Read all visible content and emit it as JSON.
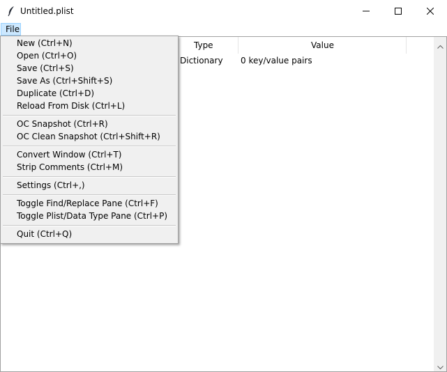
{
  "window": {
    "title": "Untitled.plist",
    "icon": "feather-icon",
    "controls": [
      "minimize-icon",
      "maximize-icon",
      "close-icon"
    ]
  },
  "menubar": {
    "file_label": "File"
  },
  "file_menu": {
    "items": [
      {
        "label": "New (Ctrl+N)"
      },
      {
        "label": "Open (Ctrl+O)"
      },
      {
        "label": "Save (Ctrl+S)"
      },
      {
        "label": "Save As (Ctrl+Shift+S)"
      },
      {
        "label": "Duplicate (Ctrl+D)"
      },
      {
        "label": "Reload From Disk (Ctrl+L)"
      },
      {
        "label": "OC Snapshot (Ctrl+R)"
      },
      {
        "label": "OC Clean Snapshot (Ctrl+Shift+R)"
      },
      {
        "label": "Convert Window (Ctrl+T)"
      },
      {
        "label": "Strip Comments (Ctrl+M)"
      },
      {
        "label": "Settings (Ctrl+,)"
      },
      {
        "label": "Toggle Find/Replace Pane (Ctrl+F)"
      },
      {
        "label": "Toggle Plist/Data Type Pane (Ctrl+P)"
      },
      {
        "label": "Quit (Ctrl+Q)"
      }
    ]
  },
  "tree": {
    "columns": [
      "Type",
      "Value"
    ],
    "rows": [
      {
        "type": "Dictionary",
        "value": "0 key/value pairs"
      }
    ]
  },
  "colors": {
    "menu_highlight": "#cce8ff",
    "menu_highlight_border": "#99d1ff",
    "menu_background": "#f0f0f0"
  }
}
